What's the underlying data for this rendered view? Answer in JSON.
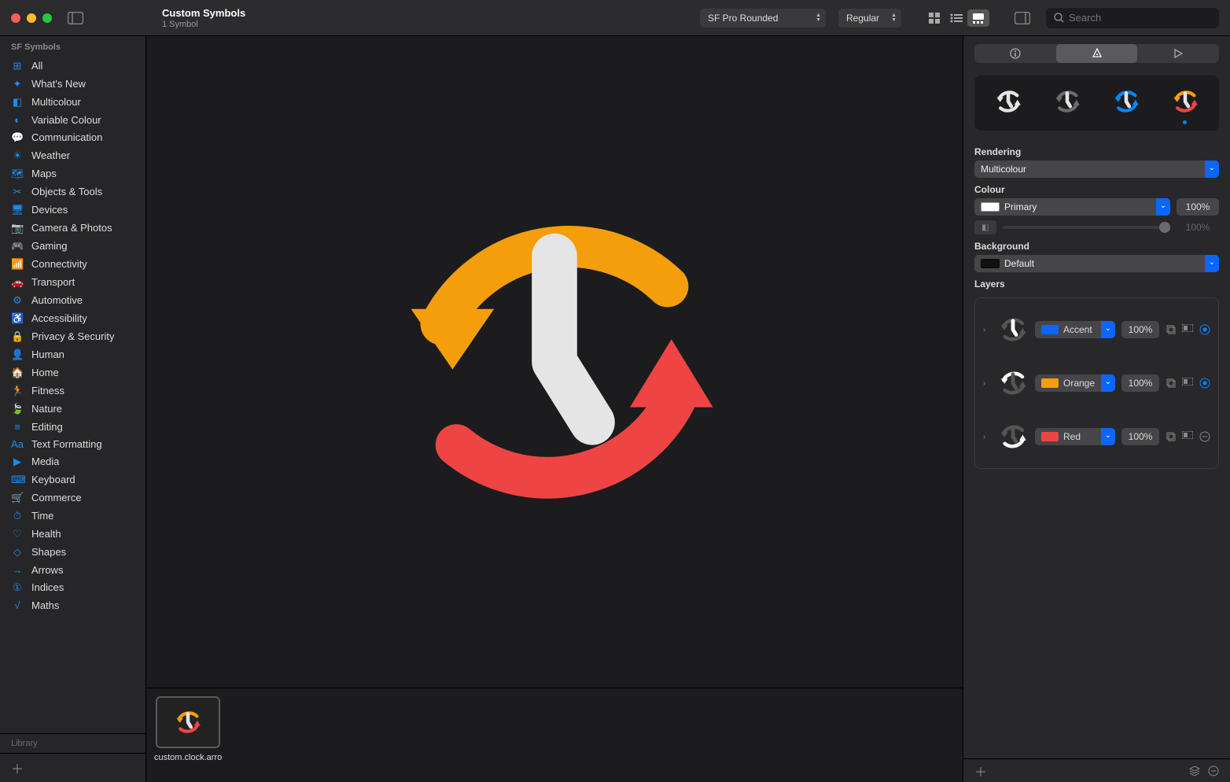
{
  "titlebar": {
    "title": "Custom Symbols",
    "subtitle": "1 Symbol",
    "font_family": "SF Pro Rounded",
    "font_weight": "Regular",
    "search_placeholder": "Search"
  },
  "sidebar": {
    "header": "SF Symbols",
    "footer": "Library",
    "items": [
      {
        "glyph": "⊞",
        "label": "All"
      },
      {
        "glyph": "✦",
        "label": "What's New"
      },
      {
        "glyph": "◧",
        "label": "Multicolour"
      },
      {
        "glyph": "◐",
        "label": "Variable Colour"
      },
      {
        "glyph": "💬",
        "label": "Communication"
      },
      {
        "glyph": "☀",
        "label": "Weather"
      },
      {
        "glyph": "🗺",
        "label": "Maps"
      },
      {
        "glyph": "✂",
        "label": "Objects & Tools"
      },
      {
        "glyph": "🖥",
        "label": "Devices"
      },
      {
        "glyph": "📷",
        "label": "Camera & Photos"
      },
      {
        "glyph": "🎮",
        "label": "Gaming"
      },
      {
        "glyph": "📶",
        "label": "Connectivity"
      },
      {
        "glyph": "🚗",
        "label": "Transport"
      },
      {
        "glyph": "⚙",
        "label": "Automotive"
      },
      {
        "glyph": "♿",
        "label": "Accessibility"
      },
      {
        "glyph": "🔒",
        "label": "Privacy & Security"
      },
      {
        "glyph": "👤",
        "label": "Human"
      },
      {
        "glyph": "🏠",
        "label": "Home"
      },
      {
        "glyph": "🏃",
        "label": "Fitness"
      },
      {
        "glyph": "🍃",
        "label": "Nature"
      },
      {
        "glyph": "≡",
        "label": "Editing"
      },
      {
        "glyph": "Aa",
        "label": "Text Formatting"
      },
      {
        "glyph": "▶",
        "label": "Media"
      },
      {
        "glyph": "⌨",
        "label": "Keyboard"
      },
      {
        "glyph": "🛒",
        "label": "Commerce"
      },
      {
        "glyph": "⏱",
        "label": "Time"
      },
      {
        "glyph": "♡",
        "label": "Health"
      },
      {
        "glyph": "◇",
        "label": "Shapes"
      },
      {
        "glyph": "→",
        "label": "Arrows"
      },
      {
        "glyph": "①",
        "label": "Indices"
      },
      {
        "glyph": "√",
        "label": "Maths"
      }
    ]
  },
  "thumb": {
    "label": "custom.clock.arrow.triangleh…"
  },
  "inspector": {
    "rendering_label": "Rendering",
    "rendering_value": "Multicolour",
    "colour_label": "Colour",
    "colour_select": "Primary",
    "colour_opacity": "100%",
    "colour_slider_disabled": "100%",
    "background_label": "Background",
    "background_value": "Default",
    "layers_label": "Layers",
    "layers": [
      {
        "colour": "Accent",
        "swatch": "#0a66ff",
        "opacity": "100%",
        "erase": "circle"
      },
      {
        "colour": "Orange",
        "swatch": "#f59e0b",
        "opacity": "100%",
        "erase": "circle"
      },
      {
        "colour": "Red",
        "swatch": "#ef4444",
        "opacity": "100%",
        "erase": "dash"
      }
    ]
  },
  "colors": {
    "orange": "#f59e0b",
    "red": "#ef4444",
    "white": "#e5e5e5",
    "accent": "#0a84ff",
    "grey": "#6b6b6e"
  }
}
